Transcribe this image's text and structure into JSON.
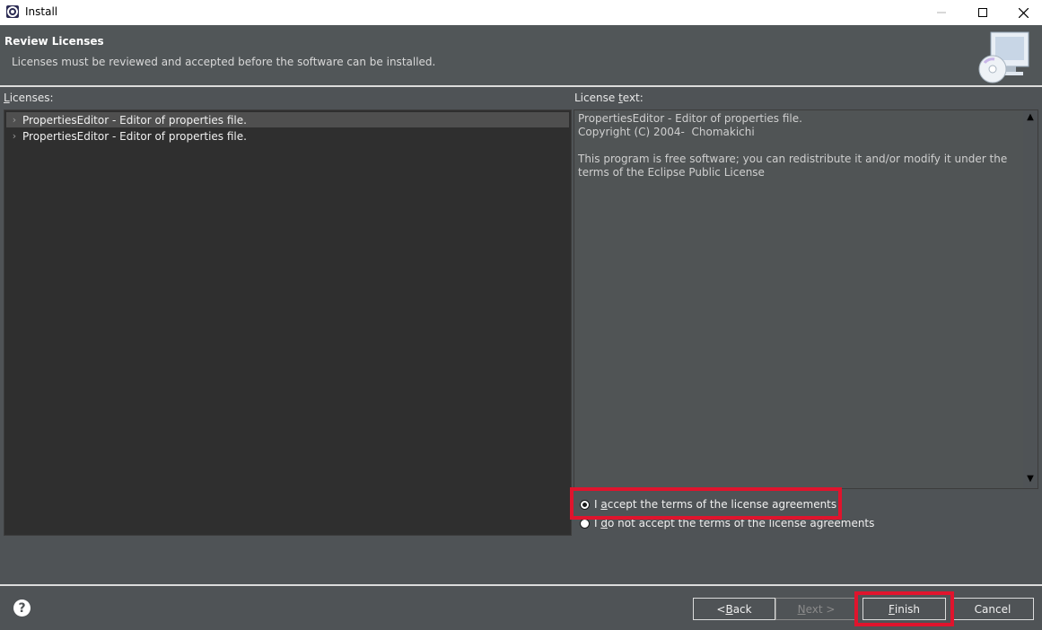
{
  "window": {
    "title": "Install"
  },
  "banner": {
    "title": "Review Licenses",
    "description": "Licenses must be reviewed and accepted before the software can be installed."
  },
  "licenses": {
    "label_mnemonic": "L",
    "label_rest": "icenses:",
    "items": [
      {
        "label": "PropertiesEditor - Editor of properties file.",
        "selected": true
      },
      {
        "label": "PropertiesEditor - Editor of properties file.",
        "selected": false
      }
    ]
  },
  "license_text": {
    "label_pre": "License ",
    "label_mnemonic": "t",
    "label_post": "ext:",
    "body": "PropertiesEditor - Editor of properties file.\nCopyright (C) 2004-  Chomakichi\n\nThis program is free software; you can redistribute it and/or modify it under the terms of the Eclipse Public License"
  },
  "agreement": {
    "accept_mnemonic": "I ",
    "accept_key": "a",
    "accept_rest": "ccept the terms of the license agreements",
    "decline_pre": "I ",
    "decline_key": "d",
    "decline_rest": "o not accept the terms of the license agreements",
    "selected": "accept"
  },
  "buttons": {
    "back_pre": "< ",
    "back_key": "B",
    "back_rest": "ack",
    "next_key": "N",
    "next_rest": "ext >",
    "finish_key": "F",
    "finish_rest": "inish",
    "cancel": "Cancel"
  },
  "help": {
    "glyph": "?"
  },
  "colors": {
    "highlight": "#e0142d",
    "background": "#4f5356",
    "tree_bg": "#2f2f2f"
  }
}
